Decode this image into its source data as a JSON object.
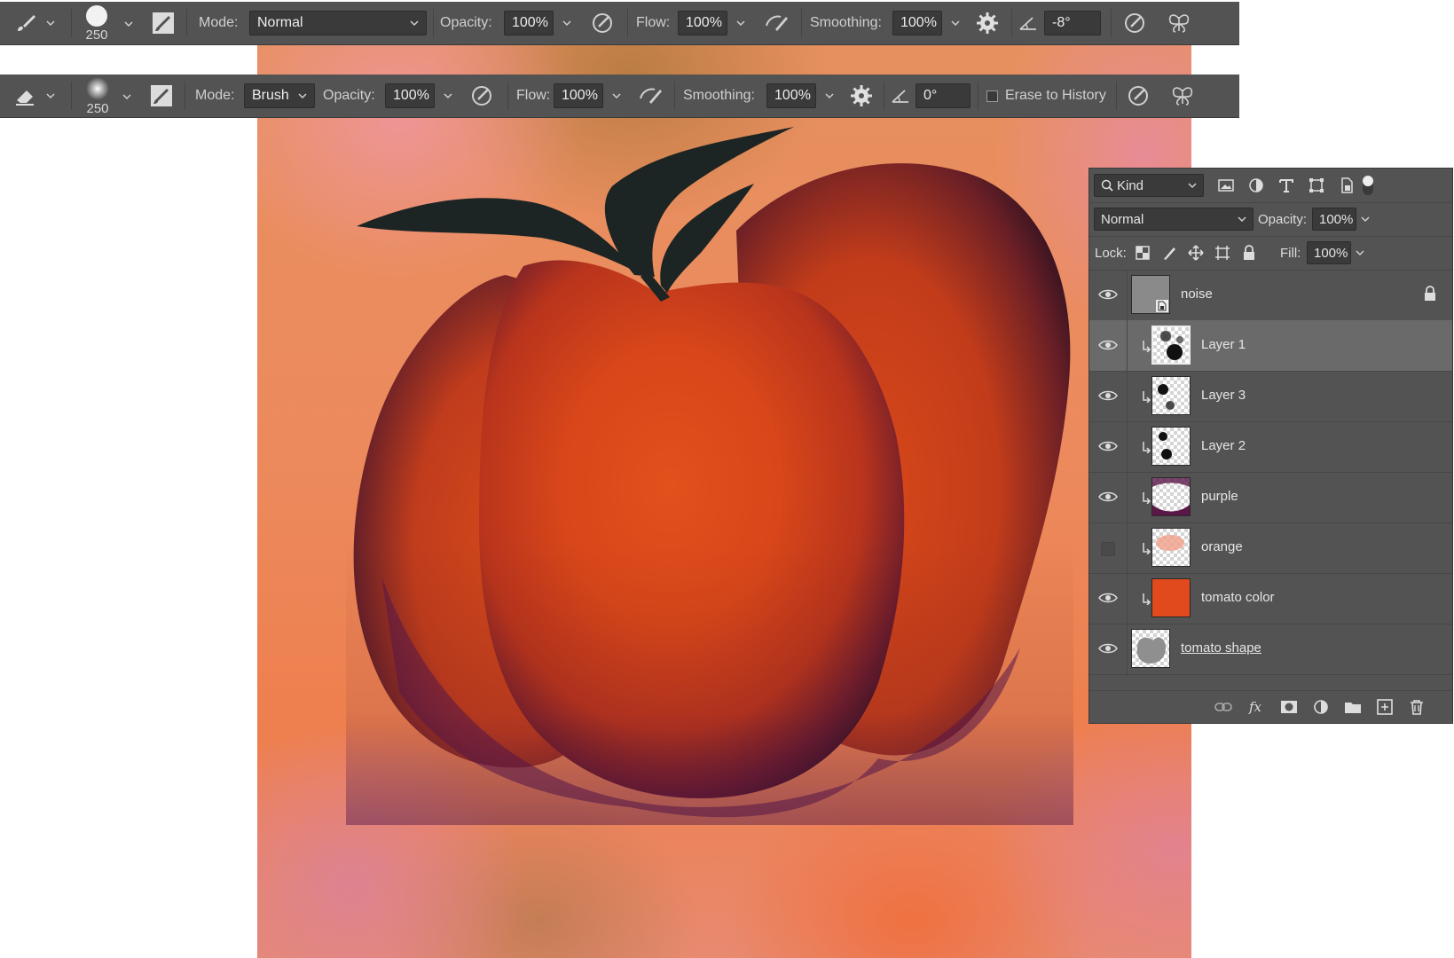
{
  "brush_bar": {
    "brush_size": "250",
    "mode_label": "Mode:",
    "mode_value": "Normal",
    "opacity_label": "Opacity:",
    "opacity_value": "100%",
    "flow_label": "Flow:",
    "flow_value": "100%",
    "smoothing_label": "Smoothing:",
    "smoothing_value": "100%",
    "angle_value": "-8°"
  },
  "eraser_bar": {
    "brush_size": "250",
    "mode_label": "Mode:",
    "mode_value": "Brush",
    "opacity_label": "Opacity:",
    "opacity_value": "100%",
    "flow_label": "Flow:",
    "flow_value": "100%",
    "smoothing_label": "Smoothing:",
    "smoothing_value": "100%",
    "angle_value": "0°",
    "erase_history_label": "Erase to History",
    "erase_history_checked": false
  },
  "layers_panel": {
    "filter_kind": "Kind",
    "blend_mode": "Normal",
    "opacity_label": "Opacity:",
    "opacity_value": "100%",
    "lock_label": "Lock:",
    "fill_label": "Fill:",
    "fill_value": "100%",
    "layers": [
      {
        "name": "noise",
        "visible": true,
        "clipped": false,
        "locked": true,
        "selected": false
      },
      {
        "name": "Layer 1",
        "visible": true,
        "clipped": true,
        "locked": false,
        "selected": true
      },
      {
        "name": "Layer 3",
        "visible": true,
        "clipped": true,
        "locked": false,
        "selected": false
      },
      {
        "name": "Layer 2",
        "visible": true,
        "clipped": true,
        "locked": false,
        "selected": false
      },
      {
        "name": "purple",
        "visible": true,
        "clipped": true,
        "locked": false,
        "selected": false
      },
      {
        "name": "orange",
        "visible": false,
        "clipped": true,
        "locked": false,
        "selected": false
      },
      {
        "name": "tomato color",
        "visible": true,
        "clipped": true,
        "locked": false,
        "selected": false
      },
      {
        "name": "tomato shape",
        "visible": true,
        "clipped": false,
        "locked": false,
        "selected": false
      }
    ],
    "footer_icons": [
      "link-icon",
      "fx-icon",
      "mask-icon",
      "adjustment-icon",
      "folder-icon",
      "new-layer-icon",
      "trash-icon"
    ]
  },
  "colors": {
    "panel_bg": "#535353",
    "field_bg": "#3a3a3a",
    "selected_layer": "#6a6a6a",
    "tomato_color": "#e04a1c",
    "leaf_color": "#1d2424"
  }
}
